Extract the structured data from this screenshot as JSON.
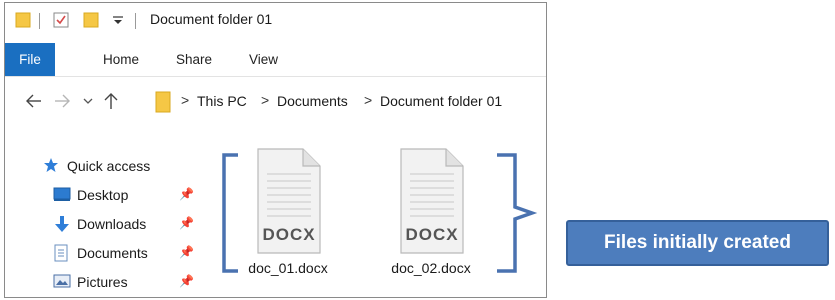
{
  "window": {
    "title": "Document folder 01"
  },
  "ribbon": {
    "tabs": [
      "File",
      "Home",
      "Share",
      "View"
    ]
  },
  "address_bar": {
    "crumbs": [
      "This PC",
      "Documents",
      "Document folder 01"
    ]
  },
  "nav_pane": {
    "quick_access": "Quick access",
    "items": [
      "Desktop",
      "Downloads",
      "Documents",
      "Pictures"
    ]
  },
  "files": [
    {
      "name": "doc_01.docx",
      "type_label": "DOCX"
    },
    {
      "name": "doc_02.docx",
      "type_label": "DOCX"
    }
  ],
  "annotation": {
    "callout_text": "Files initially created"
  },
  "colors": {
    "file_tab": "#1a6fc1",
    "callout_fill": "#4d7dbd",
    "bracket": "#4a72b0"
  },
  "icons": [
    "folder-icon",
    "checkbox-icon",
    "dropdown-icon",
    "back-arrow-icon",
    "forward-arrow-icon",
    "recent-dropdown-icon",
    "up-arrow-icon",
    "star-icon",
    "desktop-icon",
    "download-icon",
    "documents-icon",
    "pictures-icon",
    "pin-icon",
    "docx-file-icon"
  ]
}
